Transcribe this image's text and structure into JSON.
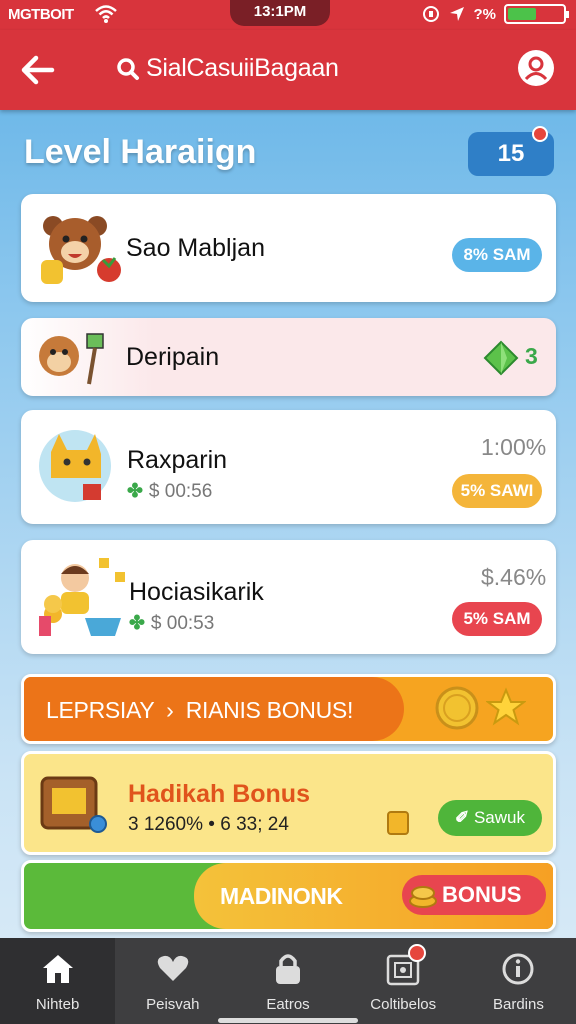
{
  "status": {
    "carrier": "MGTBOIT",
    "time": "13:1PM",
    "battery_text": "?%"
  },
  "header": {
    "title": "SialCasuiiBagaan"
  },
  "level": {
    "title": "Level Haraiign",
    "badge": "15"
  },
  "cards": [
    {
      "name": "Sao Mabljan",
      "pill": "8% SAM",
      "pill_color": "#5ab4e8"
    },
    {
      "name": "Deripain",
      "reward": "3"
    },
    {
      "name": "Raxparin",
      "sub": "$ 00:56",
      "pct": "1:00%",
      "pill": "5% SAWI",
      "pill_color": "#f4b53a"
    },
    {
      "name": "Hociasikarik",
      "sub": "$ 00:53",
      "pct": "$.46%",
      "pill": "5% SAM",
      "pill_color": "#e8454f"
    }
  ],
  "banners": {
    "orange": {
      "text": "LEPRSIAY  ›  RIANIS BONUS!"
    },
    "yellow": {
      "title": "Hadikah Bonus",
      "sub": "3 1260% • 6 33; 24",
      "button": "Sawuk"
    },
    "green": {
      "text": "MADINONK",
      "button": "BONUS"
    }
  },
  "tabs": [
    {
      "label": "Nihteb",
      "icon": "home-icon"
    },
    {
      "label": "Peisvah",
      "icon": "heart-icon"
    },
    {
      "label": "Eatros",
      "icon": "lock-icon"
    },
    {
      "label": "Coltibelos",
      "icon": "gift-icon"
    },
    {
      "label": "Bardins",
      "icon": "info-icon"
    }
  ],
  "colors": {
    "accent": "#d8343c",
    "sky": "#5fb1e6"
  }
}
